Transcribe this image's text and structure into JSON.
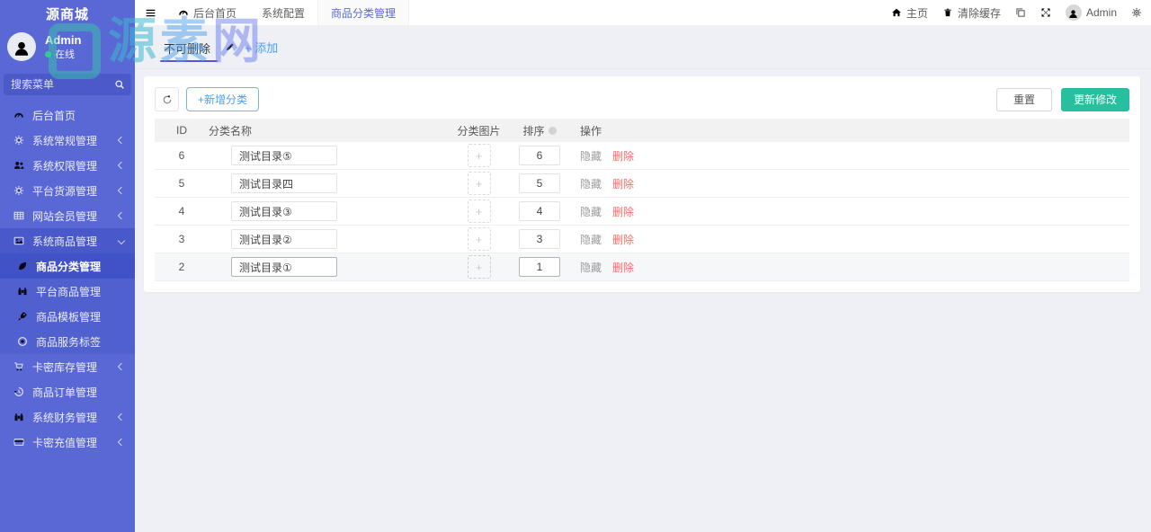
{
  "watermark": {
    "text_chars": [
      "源",
      "素",
      "网"
    ]
  },
  "sidebar": {
    "logo_text": "源商城",
    "user": {
      "name": "Admin",
      "status": "在线"
    },
    "search_placeholder": "搜索菜单",
    "items": [
      {
        "label": "后台首页",
        "icon": "tachometer-icon"
      },
      {
        "label": "系统常规管理",
        "icon": "cogs-icon",
        "chevron": "left"
      },
      {
        "label": "系统权限管理",
        "icon": "users-icon",
        "chevron": "left"
      },
      {
        "label": "平台货源管理",
        "icon": "cogs-icon",
        "chevron": "left"
      },
      {
        "label": "网站会员管理",
        "icon": "table-icon",
        "chevron": "left"
      },
      {
        "label": "系统商品管理",
        "icon": "image-icon",
        "chevron": "down",
        "expanded": true
      },
      {
        "label": "商品分类管理",
        "icon": "leaf-icon",
        "active": true
      },
      {
        "label": "平台商品管理",
        "icon": "binoculars-icon"
      },
      {
        "label": "商品模板管理",
        "icon": "rocket-icon"
      },
      {
        "label": "商品服务标签",
        "icon": "dot-circle-icon"
      },
      {
        "label": "卡密库存管理",
        "icon": "cart-icon",
        "chevron": "left"
      },
      {
        "label": "商品订单管理",
        "icon": "history-icon"
      },
      {
        "label": "系统财务管理",
        "icon": "binoculars-icon",
        "chevron": "left"
      },
      {
        "label": "卡密充值管理",
        "icon": "credit-card-icon",
        "chevron": "left"
      }
    ]
  },
  "topbar": {
    "tabs": [
      {
        "label": "后台首页",
        "icon": "tachometer-icon"
      },
      {
        "label": "系统配置"
      },
      {
        "label": "商品分类管理",
        "active": true
      }
    ],
    "home_label": "主页",
    "clear_cache_label": "清除缓存",
    "username": "Admin",
    "right_icons": [
      "home-icon",
      "trash-icon",
      "clone-icon",
      "expand-icon",
      "avatar",
      "gear-icon"
    ]
  },
  "tabstrip": {
    "active_tab": "不可删除",
    "add_label": "+ 添加"
  },
  "toolbar": {
    "add_label": "+新增分类",
    "reset_label": "重置",
    "update_label": "更新修改"
  },
  "table": {
    "headers": [
      "ID",
      "分类名称",
      "分类图片",
      "排序",
      "操作"
    ],
    "upload_plus": "+",
    "hide_label": "隐藏",
    "delete_label": "删除",
    "rows": [
      {
        "id": "6",
        "name": "测试目录⑤",
        "sort": "6"
      },
      {
        "id": "5",
        "name": "测试目录四",
        "sort": "5"
      },
      {
        "id": "4",
        "name": "测试目录③",
        "sort": "4"
      },
      {
        "id": "3",
        "name": "测试目录②",
        "sort": "3"
      },
      {
        "id": "2",
        "name": "测试目录①",
        "sort": "1",
        "highlighted": true
      }
    ]
  },
  "colors": {
    "theme": "#5a68d5",
    "green_button": "#29bf9e",
    "blue_button": "#4aa0f5",
    "delete_red": "#f56c6c",
    "content_bg": "#eef0f5"
  }
}
